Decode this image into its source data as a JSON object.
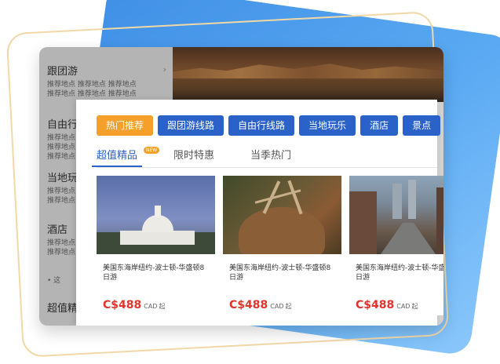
{
  "sidebar": {
    "groups": [
      {
        "title": "跟团游",
        "rows": [
          "推荐地点 推荐地点 推荐地点",
          "推荐地点 推荐地点 推荐地点"
        ]
      },
      {
        "title": "自由行",
        "rows": [
          "推荐地点",
          "推荐地点",
          "推荐地点"
        ]
      },
      {
        "title": "当地玩乐",
        "rows": [
          "推荐地点",
          "推荐地点"
        ]
      },
      {
        "title": "酒店",
        "rows": [
          "推荐地点",
          "推荐地点"
        ]
      },
      {
        "title": "超值精",
        "rows": []
      }
    ],
    "footer": "• 这"
  },
  "nav": {
    "buttons": [
      "热门推荐",
      "跟团游线路",
      "自由行线路",
      "当地玩乐",
      "酒店",
      "景点"
    ]
  },
  "tabs": {
    "items": [
      "超值精品",
      "限时特惠",
      "当季热门"
    ],
    "badge": "NEW"
  },
  "products": [
    {
      "name": "美国东海岸纽约-波士顿-华盛顿8日游",
      "price": "C$488",
      "currency": "CAD",
      "suffix": "起",
      "image": "capitol-building"
    },
    {
      "name": "美国东海岸纽约-波士顿-华盛顿8日游",
      "price": "C$488",
      "currency": "CAD",
      "suffix": "起",
      "image": "elk"
    },
    {
      "name": "美国东海岸纽约-波士顿-华盛顿8日游",
      "price": "C$488",
      "currency": "CAD",
      "suffix": "起",
      "image": "city-street"
    }
  ],
  "colors": {
    "primary": "#2a62c9",
    "accent": "#f5a02a",
    "price": "#e0352c"
  }
}
